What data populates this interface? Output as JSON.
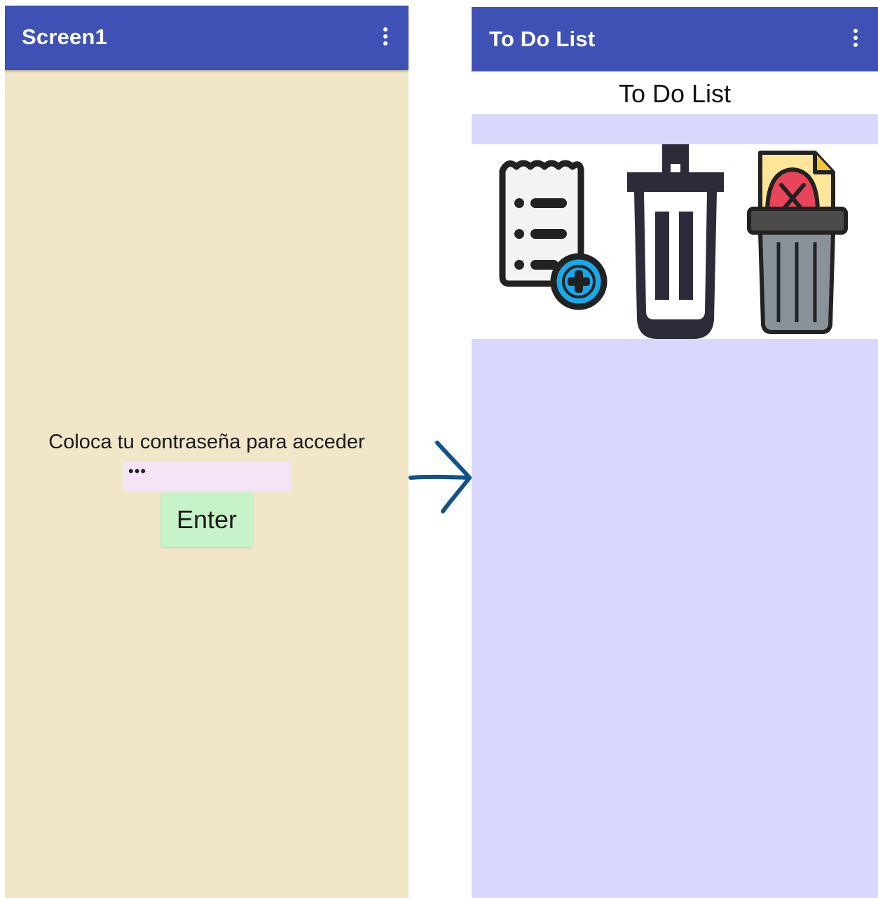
{
  "screen1": {
    "title": "Screen1",
    "menu_icon": "more-vert-icon",
    "prompt_label": "Coloca tu contraseña para acceder",
    "password_value": "•••",
    "enter_label": "Enter"
  },
  "arrow_icon": "arrow-right-icon",
  "todo_screen": {
    "title": "To Do List",
    "menu_icon": "more-vert-icon",
    "heading": "To Do List",
    "actions": [
      {
        "name": "add-task",
        "icon": "add-list-icon"
      },
      {
        "name": "delete-task",
        "icon": "trash-can-icon"
      },
      {
        "name": "delete-all",
        "icon": "discard-document-icon"
      }
    ]
  },
  "colors": {
    "appbar": "#3f51b5",
    "screen1_background": "#f1e7c8",
    "todo_background": "#d9d8fc",
    "password_field": "#f3e5f5",
    "enter_button": "#c8f3c8",
    "arrow": "#12528a"
  }
}
